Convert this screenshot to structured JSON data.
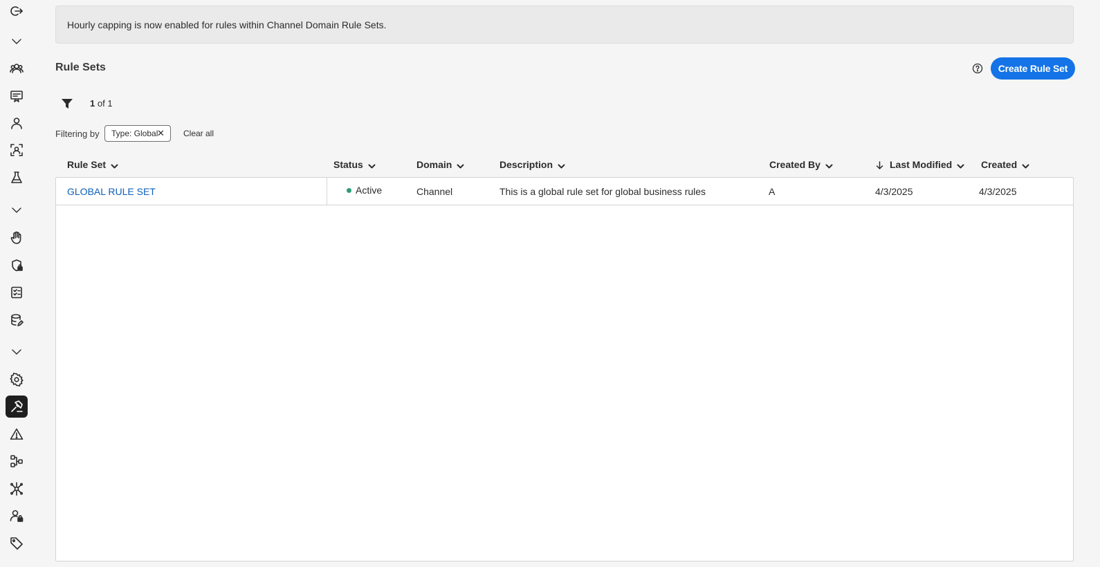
{
  "banner": {
    "text": "Hourly capping is now enabled for rules within Channel Domain Rule Sets."
  },
  "header": {
    "title": "Rule Sets",
    "create_button": "Create Rule Set"
  },
  "pagination": {
    "current": "1",
    "of_text": "of 1"
  },
  "filters": {
    "label": "Filtering by",
    "chips": [
      {
        "label": "Type: Global"
      }
    ],
    "clear_all": "Clear all"
  },
  "table": {
    "columns": [
      "Rule Set",
      "Status",
      "Domain",
      "Description",
      "Created By",
      "Last Modified",
      "Created"
    ],
    "sorted_column": "Last Modified",
    "sort_direction": "descending",
    "rows": [
      {
        "rule_set": "GLOBAL RULE SET",
        "status": "Active",
        "domain": "Channel",
        "description": "This is a global rule set for global business rules",
        "created_by": "A",
        "last_modified": "4/3/2025",
        "created": "4/3/2025"
      }
    ]
  },
  "sidebar": {
    "icons": [
      "logout-icon",
      "chevron-down-icon",
      "audiences-icon",
      "content-icon",
      "profile-icon",
      "segments-icon",
      "experiments-icon",
      "chevron-down-icon",
      "consent-icon",
      "privacy-icon",
      "checklist-icon",
      "data-icon",
      "chevron-down-icon",
      "settings-icon",
      "business-rules-icon",
      "alerts-icon",
      "workflows-icon",
      "integrations-icon",
      "permissions-icon",
      "tags-icon"
    ],
    "active": "business-rules-icon"
  },
  "colors": {
    "accent": "#1473e6",
    "status_active": "#2d9d78",
    "link": "#0d5fb8"
  }
}
